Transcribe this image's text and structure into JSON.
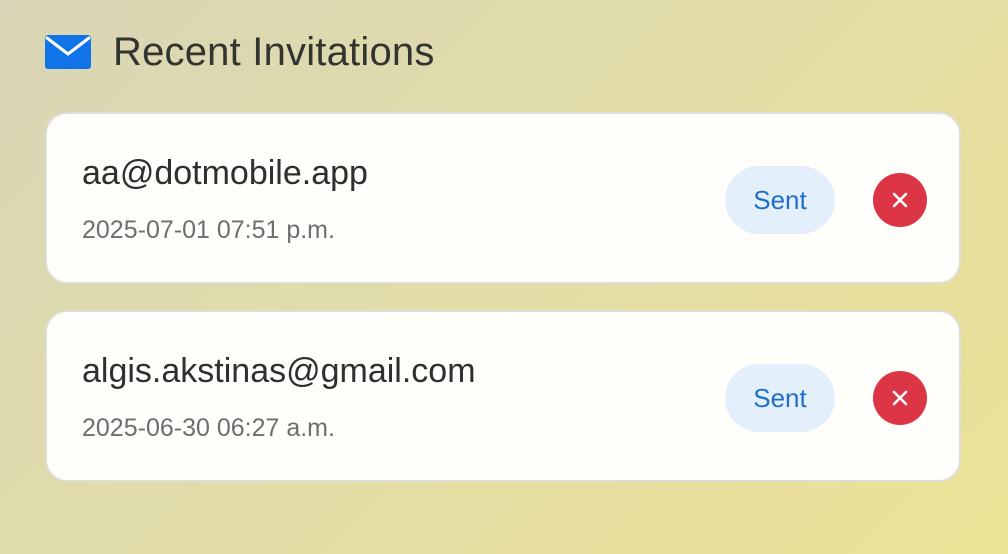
{
  "header": {
    "icon": "mail-icon",
    "title": "Recent Invitations"
  },
  "colors": {
    "icon_blue": "#1173e8",
    "badge_bg": "#e3f0fc",
    "badge_text": "#1f6fc9",
    "delete_red": "#dc3545"
  },
  "invitations": [
    {
      "email": "aa@dotmobile.app",
      "timestamp": "2025-07-01 07:51 p.m.",
      "status": "Sent",
      "delete_icon": "close-icon"
    },
    {
      "email": "algis.akstinas@gmail.com",
      "timestamp": "2025-06-30 06:27 a.m.",
      "status": "Sent",
      "delete_icon": "close-icon"
    }
  ]
}
